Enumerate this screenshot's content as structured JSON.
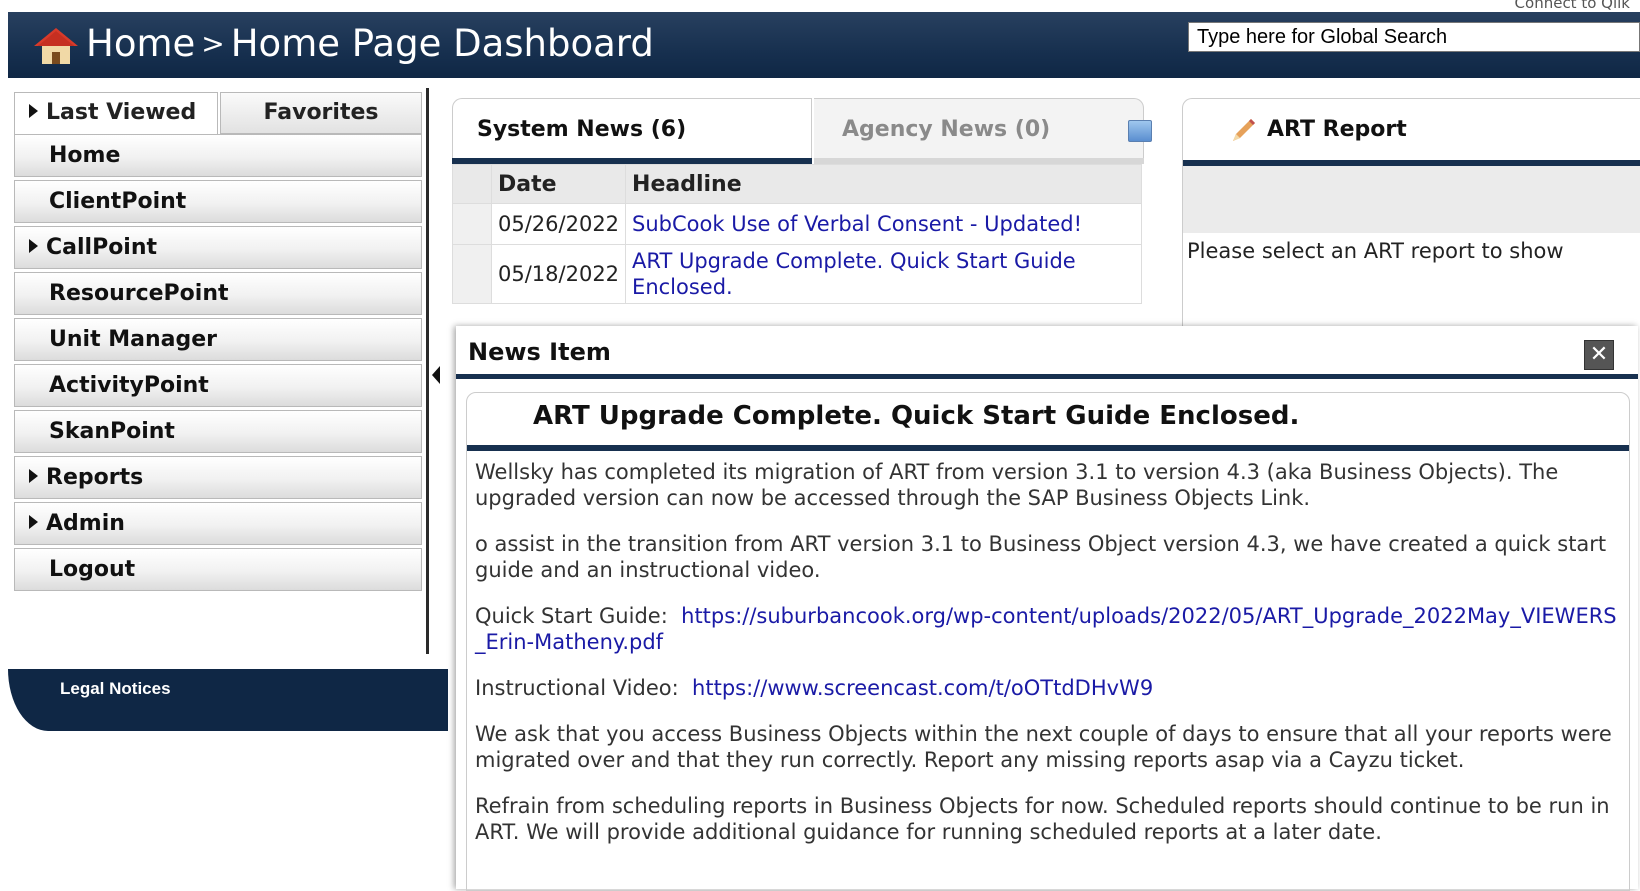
{
  "header": {
    "top_link": "Connect to Qlik",
    "breadcrumb_root": "Home",
    "breadcrumb_sep": ">",
    "breadcrumb_page": "Home Page Dashboard",
    "search_placeholder": "Type here for Global Search"
  },
  "sidebar": {
    "tabs": [
      {
        "label": "Last Viewed",
        "active": true
      },
      {
        "label": "Favorites",
        "active": false
      }
    ],
    "items": [
      {
        "label": "Home",
        "has_sub": false
      },
      {
        "label": "ClientPoint",
        "has_sub": false
      },
      {
        "label": "CallPoint",
        "has_sub": true
      },
      {
        "label": "ResourcePoint",
        "has_sub": false
      },
      {
        "label": "Unit Manager",
        "has_sub": false
      },
      {
        "label": "ActivityPoint",
        "has_sub": false
      },
      {
        "label": "SkanPoint",
        "has_sub": false
      },
      {
        "label": "Reports",
        "has_sub": true
      },
      {
        "label": "Admin",
        "has_sub": true
      },
      {
        "label": "Logout",
        "has_sub": false
      }
    ],
    "legal": "Legal Notices"
  },
  "news": {
    "tabs": [
      {
        "label": "System News (6)",
        "active": true
      },
      {
        "label": "Agency News (0)",
        "active": false
      }
    ],
    "columns": [
      "Date",
      "Headline"
    ],
    "rows": [
      {
        "date": "05/26/2022",
        "headline": "SubCook Use of Verbal Consent - Updated!"
      },
      {
        "date": "05/18/2022",
        "headline": "ART Upgrade Complete. Quick Start Guide Enclosed."
      }
    ]
  },
  "art_report": {
    "title": "ART Report",
    "message": "Please select an ART report to show"
  },
  "modal": {
    "title": "News Item",
    "close": "✕",
    "headline": "ART Upgrade Complete. Quick Start Guide Enclosed.",
    "paragraphs": [
      "Wellsky has completed its migration of ART from version 3.1 to version 4.3 (aka Business Objects). The upgraded version can now be accessed through the SAP Business Objects Link.",
      "o assist in the transition from ART version 3.1 to Business Object version 4.3, we have created a quick start guide and an instructional video."
    ],
    "guide_label": "Quick Start Guide:",
    "guide_link": "https://suburbancook.org/wp-content/uploads/2022/05/ART_Upgrade_2022May_VIEWERS_Erin-Matheny.pdf",
    "video_label": "Instructional Video:",
    "video_link": "https://www.screencast.com/t/oOTtdDHvW9",
    "paragraph3": "We ask that you access Business Objects within the next couple of days to ensure that all your reports were migrated over and that they run correctly.  Report any missing reports asap via a Cayzu ticket.",
    "paragraph4": "Refrain from scheduling reports in Business Objects for now.  Scheduled reports should continue to be run in ART. We will provide additional guidance for running scheduled reports at a later date."
  }
}
